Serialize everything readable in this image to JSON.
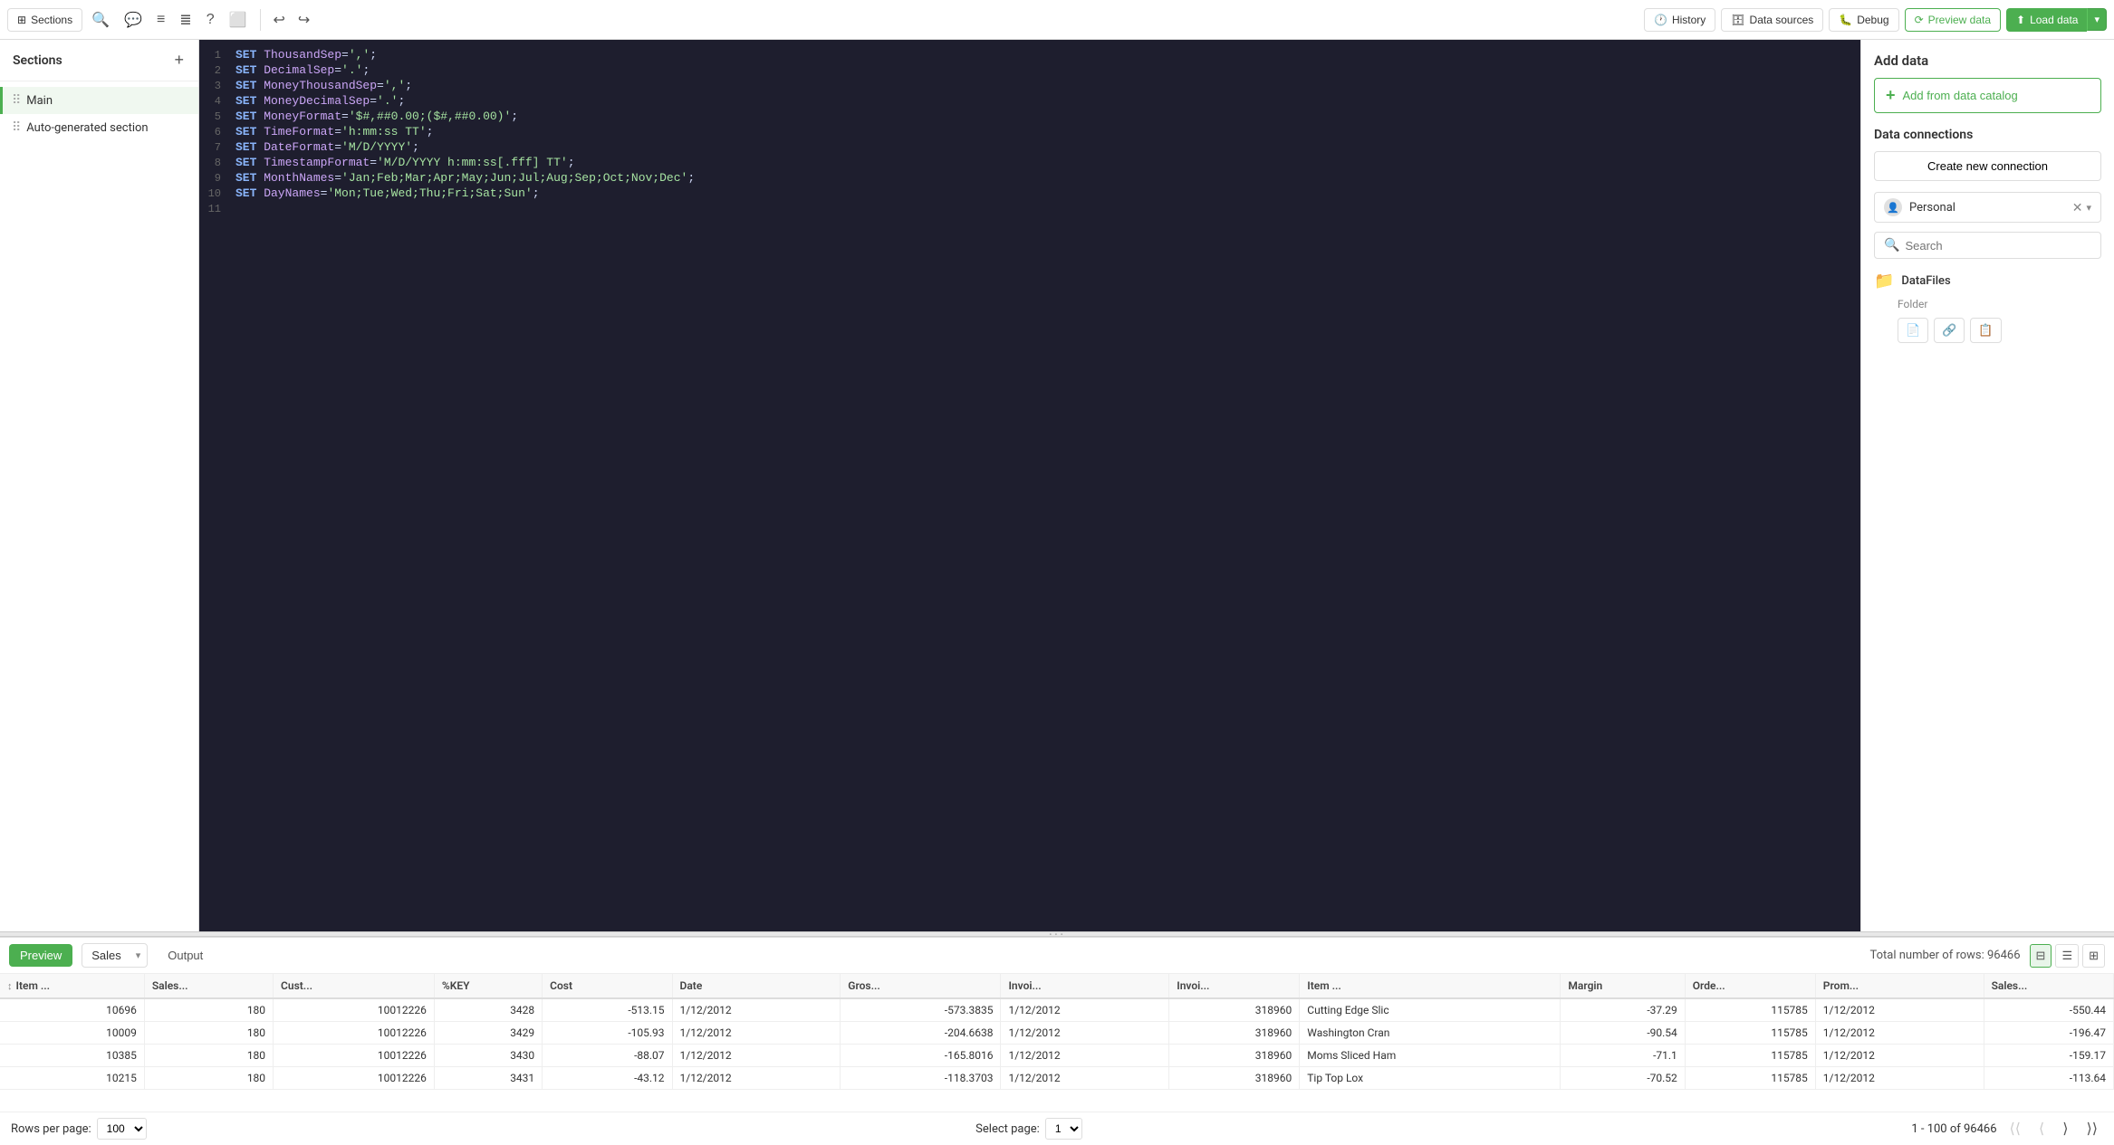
{
  "toolbar": {
    "sections_label": "Sections",
    "history_label": "History",
    "data_sources_label": "Data sources",
    "debug_label": "Debug",
    "preview_label": "Preview data",
    "load_label": "Load data"
  },
  "sections": {
    "title": "Sections",
    "items": [
      {
        "id": "main",
        "name": "Main",
        "active": true
      },
      {
        "id": "auto",
        "name": "Auto-generated section",
        "active": false
      }
    ]
  },
  "editor": {
    "lines": [
      {
        "num": 1,
        "code": "SET ThousandSep=',';",
        "tokens": [
          {
            "t": "kw",
            "v": "SET"
          },
          {
            "t": "var",
            "v": " ThousandSep"
          },
          {
            "t": "plain",
            "v": "="
          },
          {
            "t": "str",
            "v": "','"
          },
          {
            "t": "plain",
            "v": ";"
          }
        ]
      },
      {
        "num": 2,
        "code": "SET DecimalSep='.';",
        "tokens": [
          {
            "t": "kw",
            "v": "SET"
          },
          {
            "t": "var",
            "v": " DecimalSep"
          },
          {
            "t": "plain",
            "v": "="
          },
          {
            "t": "str",
            "v": "'.'"
          },
          {
            "t": "plain",
            "v": ";"
          }
        ]
      },
      {
        "num": 3,
        "code": "SET MoneyThousandSep=',';",
        "tokens": [
          {
            "t": "kw",
            "v": "SET"
          },
          {
            "t": "var",
            "v": " MoneyThousandSep"
          },
          {
            "t": "plain",
            "v": "="
          },
          {
            "t": "str",
            "v": "','"
          },
          {
            "t": "plain",
            "v": ";"
          }
        ]
      },
      {
        "num": 4,
        "code": "SET MoneyDecimalSep='.';",
        "tokens": [
          {
            "t": "kw",
            "v": "SET"
          },
          {
            "t": "var",
            "v": " MoneyDecimalSep"
          },
          {
            "t": "plain",
            "v": "="
          },
          {
            "t": "str",
            "v": "'.'"
          },
          {
            "t": "plain",
            "v": ";"
          }
        ]
      },
      {
        "num": 5,
        "code": "SET MoneyFormat='$#,##0.00;($#,##0.00)';",
        "tokens": [
          {
            "t": "kw",
            "v": "SET"
          },
          {
            "t": "var",
            "v": " MoneyFormat"
          },
          {
            "t": "plain",
            "v": "="
          },
          {
            "t": "str",
            "v": "'$#,##0.00;($#,##0.00)'"
          },
          {
            "t": "plain",
            "v": ";"
          }
        ]
      },
      {
        "num": 6,
        "code": "SET TimeFormat='h:mm:ss TT';",
        "tokens": [
          {
            "t": "kw",
            "v": "SET"
          },
          {
            "t": "var",
            "v": " TimeFormat"
          },
          {
            "t": "plain",
            "v": "="
          },
          {
            "t": "str",
            "v": "'h:mm:ss TT'"
          },
          {
            "t": "plain",
            "v": ";"
          }
        ]
      },
      {
        "num": 7,
        "code": "SET DateFormat='M/D/YYYY';",
        "tokens": [
          {
            "t": "kw",
            "v": "SET"
          },
          {
            "t": "var",
            "v": " DateFormat"
          },
          {
            "t": "plain",
            "v": "="
          },
          {
            "t": "str",
            "v": "'M/D/YYYY'"
          },
          {
            "t": "plain",
            "v": ";"
          }
        ]
      },
      {
        "num": 8,
        "code": "SET TimestampFormat='M/D/YYYY h:mm:ss[.fff] TT';",
        "tokens": [
          {
            "t": "kw",
            "v": "SET"
          },
          {
            "t": "var",
            "v": " TimestampFormat"
          },
          {
            "t": "plain",
            "v": "="
          },
          {
            "t": "str",
            "v": "'M/D/YYYY h:mm:ss[.fff] TT'"
          },
          {
            "t": "plain",
            "v": ";"
          }
        ]
      },
      {
        "num": 9,
        "code": "SET MonthNames='Jan;Feb;Mar;Apr;May;Jun;Jul;Aug;Sep;Oct;Nov;Dec';",
        "tokens": [
          {
            "t": "kw",
            "v": "SET"
          },
          {
            "t": "var",
            "v": " MonthNames"
          },
          {
            "t": "plain",
            "v": "="
          },
          {
            "t": "str",
            "v": "'Jan;Feb;Mar;Apr;May;Jun;Jul;Aug;Sep;Oct;Nov;Dec'"
          },
          {
            "t": "plain",
            "v": ";"
          }
        ]
      },
      {
        "num": 10,
        "code": "SET DayNames='Mon;Tue;Wed;Thu;Fri;Sat;Sun';",
        "tokens": [
          {
            "t": "kw",
            "v": "SET"
          },
          {
            "t": "var",
            "v": " DayNames"
          },
          {
            "t": "plain",
            "v": "="
          },
          {
            "t": "str",
            "v": "'Mon;Tue;Wed;Thu;Fri;Sat;Sun'"
          },
          {
            "t": "plain",
            "v": ";"
          }
        ]
      },
      {
        "num": 11,
        "code": "",
        "tokens": []
      }
    ]
  },
  "right_panel": {
    "add_data_title": "Add data",
    "add_catalog_label": "Add from data catalog",
    "data_connections_title": "Data connections",
    "create_connection_label": "Create new connection",
    "connection_name": "Personal",
    "search_placeholder": "Search",
    "datafiles_label": "DataFiles",
    "folder_label": "Folder",
    "folder_action1": "📄",
    "folder_action2": "🔗",
    "folder_action3": "📋"
  },
  "preview": {
    "tab_preview": "Preview",
    "table_name": "Sales",
    "tab_output": "Output",
    "total_rows_label": "Total number of rows: 96466",
    "columns": [
      {
        "id": "item_num",
        "label": "Item ...",
        "sort": true
      },
      {
        "id": "sales_num",
        "label": "Sales...",
        "sort": false
      },
      {
        "id": "cust",
        "label": "Cust...",
        "sort": false
      },
      {
        "id": "pkey",
        "label": "%KEY",
        "sort": false
      },
      {
        "id": "cost",
        "label": "Cost",
        "sort": false
      },
      {
        "id": "date",
        "label": "Date",
        "sort": false
      },
      {
        "id": "gros",
        "label": "Gros...",
        "sort": false
      },
      {
        "id": "invoi1",
        "label": "Invoi...",
        "sort": false
      },
      {
        "id": "invoi2",
        "label": "Invoi...",
        "sort": false
      },
      {
        "id": "item_desc",
        "label": "Item ...",
        "sort": false
      },
      {
        "id": "margin",
        "label": "Margin",
        "sort": false
      },
      {
        "id": "orde",
        "label": "Orde...",
        "sort": false
      },
      {
        "id": "prom",
        "label": "Prom...",
        "sort": false
      },
      {
        "id": "sales2",
        "label": "Sales...",
        "sort": false
      }
    ],
    "rows": [
      {
        "item_num": "10696",
        "sales_num": "180",
        "cust": "10012226",
        "pkey": "3428",
        "cost": "-513.15",
        "date": "1/12/2012",
        "gros": "-573.3835",
        "invoi1": "1/12/2012",
        "invoi2": "318960",
        "item_desc": "Cutting Edge Slic",
        "margin": "-37.29",
        "orde": "115785",
        "prom": "1/12/2012",
        "sales2": "-550.44"
      },
      {
        "item_num": "10009",
        "sales_num": "180",
        "cust": "10012226",
        "pkey": "3429",
        "cost": "-105.93",
        "date": "1/12/2012",
        "gros": "-204.6638",
        "invoi1": "1/12/2012",
        "invoi2": "318960",
        "item_desc": "Washington Cran",
        "margin": "-90.54",
        "orde": "115785",
        "prom": "1/12/2012",
        "sales2": "-196.47"
      },
      {
        "item_num": "10385",
        "sales_num": "180",
        "cust": "10012226",
        "pkey": "3430",
        "cost": "-88.07",
        "date": "1/12/2012",
        "gros": "-165.8016",
        "invoi1": "1/12/2012",
        "invoi2": "318960",
        "item_desc": "Moms Sliced Ham",
        "margin": "-71.1",
        "orde": "115785",
        "prom": "1/12/2012",
        "sales2": "-159.17"
      },
      {
        "item_num": "10215",
        "sales_num": "180",
        "cust": "10012226",
        "pkey": "3431",
        "cost": "-43.12",
        "date": "1/12/2012",
        "gros": "-118.3703",
        "invoi1": "1/12/2012",
        "invoi2": "318960",
        "item_desc": "Tip Top Lox",
        "margin": "-70.52",
        "orde": "115785",
        "prom": "1/12/2012",
        "sales2": "-113.64"
      }
    ]
  },
  "pagination": {
    "rows_per_page_label": "Rows per page:",
    "rows_per_page_value": "100",
    "select_page_label": "Select page:",
    "select_page_value": "1",
    "page_info": "1 - 100 of 96466"
  }
}
